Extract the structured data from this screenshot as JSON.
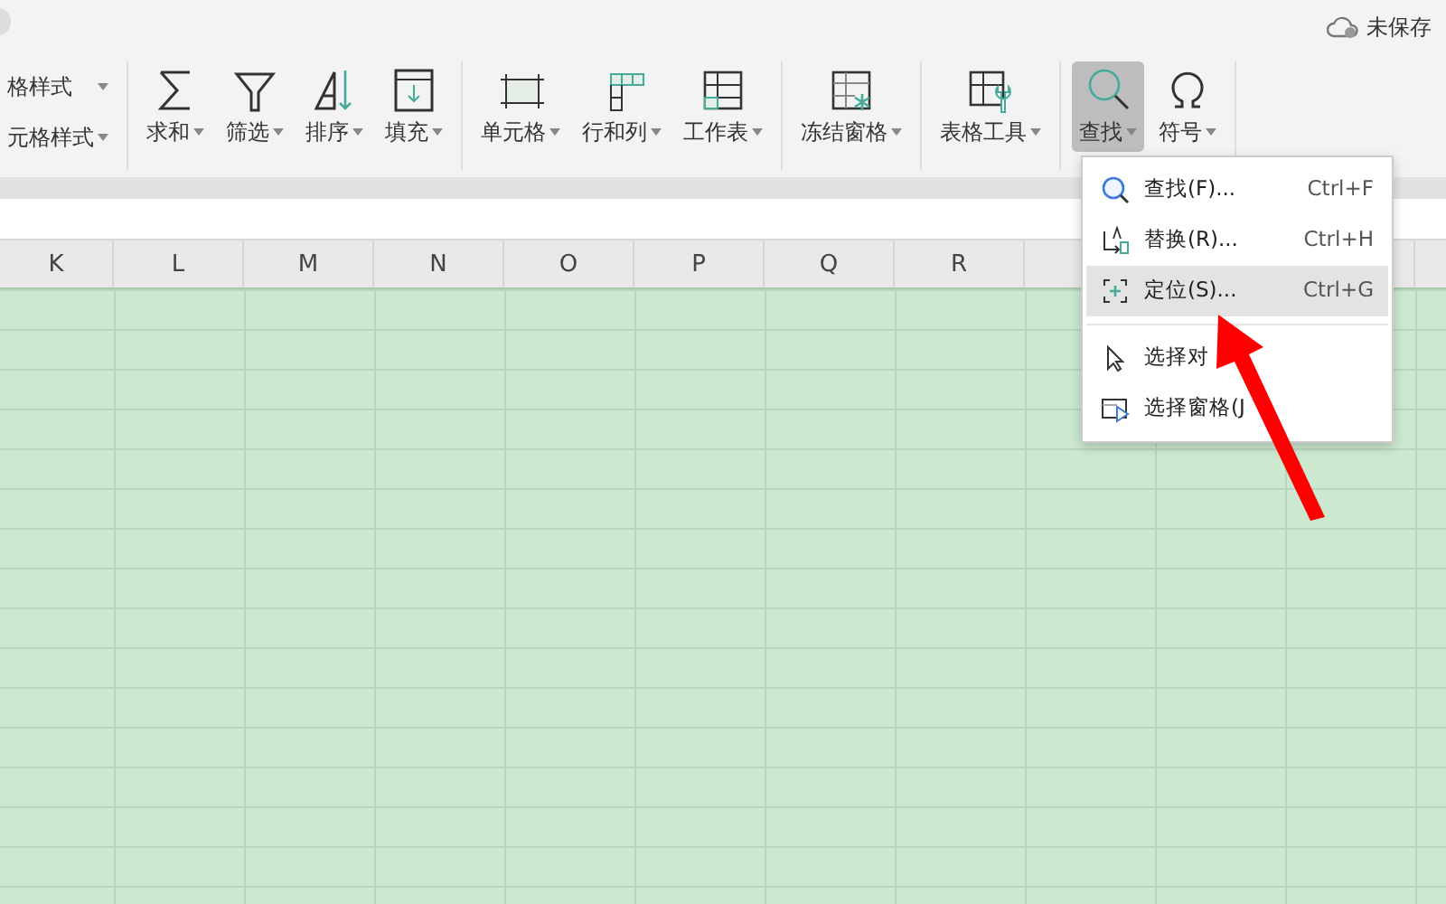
{
  "top_bar": {
    "save_status": "未保存"
  },
  "ribbon": {
    "style_items": [
      "格样式",
      "元格样式"
    ],
    "groups": [
      [
        {
          "kind": "sum",
          "label": "求和",
          "selected": false
        },
        {
          "kind": "filter",
          "label": "筛选",
          "selected": false
        },
        {
          "kind": "sort",
          "label": "排序",
          "selected": false
        },
        {
          "kind": "fill",
          "label": "填充",
          "selected": false
        }
      ],
      [
        {
          "kind": "cell",
          "label": "单元格",
          "selected": false
        },
        {
          "kind": "rowcol",
          "label": "行和列",
          "selected": false
        },
        {
          "kind": "sheet",
          "label": "工作表",
          "selected": false
        }
      ],
      [
        {
          "kind": "freeze",
          "label": "冻结窗格",
          "selected": false
        }
      ],
      [
        {
          "kind": "tools",
          "label": "表格工具",
          "selected": false
        }
      ],
      [
        {
          "kind": "find",
          "label": "查找",
          "selected": true
        },
        {
          "kind": "symbol",
          "label": "符号",
          "selected": false
        }
      ]
    ]
  },
  "columns": [
    "K",
    "L",
    "M",
    "N",
    "O",
    "P",
    "Q",
    "R"
  ],
  "find_menu": {
    "sections": [
      [
        {
          "kind": "find",
          "label": "查找(F)...",
          "shortcut": "Ctrl+F",
          "highlighted": false
        },
        {
          "kind": "replace",
          "label": "替换(R)...",
          "shortcut": "Ctrl+H",
          "highlighted": false
        },
        {
          "kind": "goto",
          "label": "定位(S)...",
          "shortcut": "Ctrl+G",
          "highlighted": true
        }
      ],
      [
        {
          "kind": "pointer",
          "label": "选择对",
          "highlighted": false
        },
        {
          "kind": "pane",
          "label": "选择窗格(J",
          "highlighted": false
        }
      ]
    ]
  }
}
